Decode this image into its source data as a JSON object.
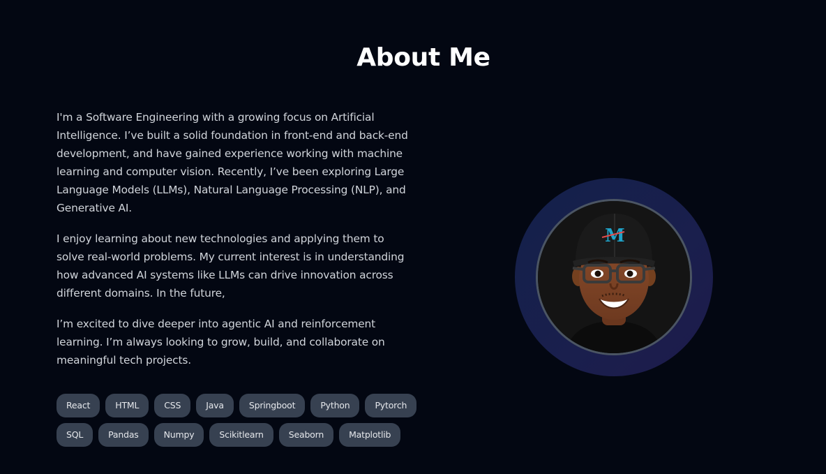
{
  "about": {
    "title": "About Me",
    "paragraphs": [
      "I'm a Software Engineering with a growing focus on Artificial Intelligence. I’ve built a solid foundation in front-end and back-end development, and have gained experience working with machine learning and computer vision. Recently, I’ve been exploring Large Language Models (LLMs), Natural Language Processing (NLP), and Generative AI.",
      "I enjoy learning about new technologies and applying them to solve real-world problems. My current interest is in understanding how advanced AI systems like LLMs can drive innovation across different domains. In the future,",
      "I’m excited to dive deeper into agentic AI and reinforcement learning. I’m always looking to grow, build, and collaborate on meaningful tech projects."
    ],
    "skills": [
      "React",
      "HTML",
      "CSS",
      "Java",
      "Springboot",
      "Python",
      "Pytorch",
      "SQL",
      "Pandas",
      "Numpy",
      "Scikitlearn",
      "Seaborn",
      "Matplotlib"
    ]
  },
  "avatar": {
    "icon": "memoji-avatar-icon",
    "ring_color": "#1a1f4d",
    "border_color": "#4b5563"
  },
  "colors": {
    "background": "#030712",
    "tag_background": "#374151",
    "title": "#ffffff",
    "text": "#d1d5db"
  }
}
